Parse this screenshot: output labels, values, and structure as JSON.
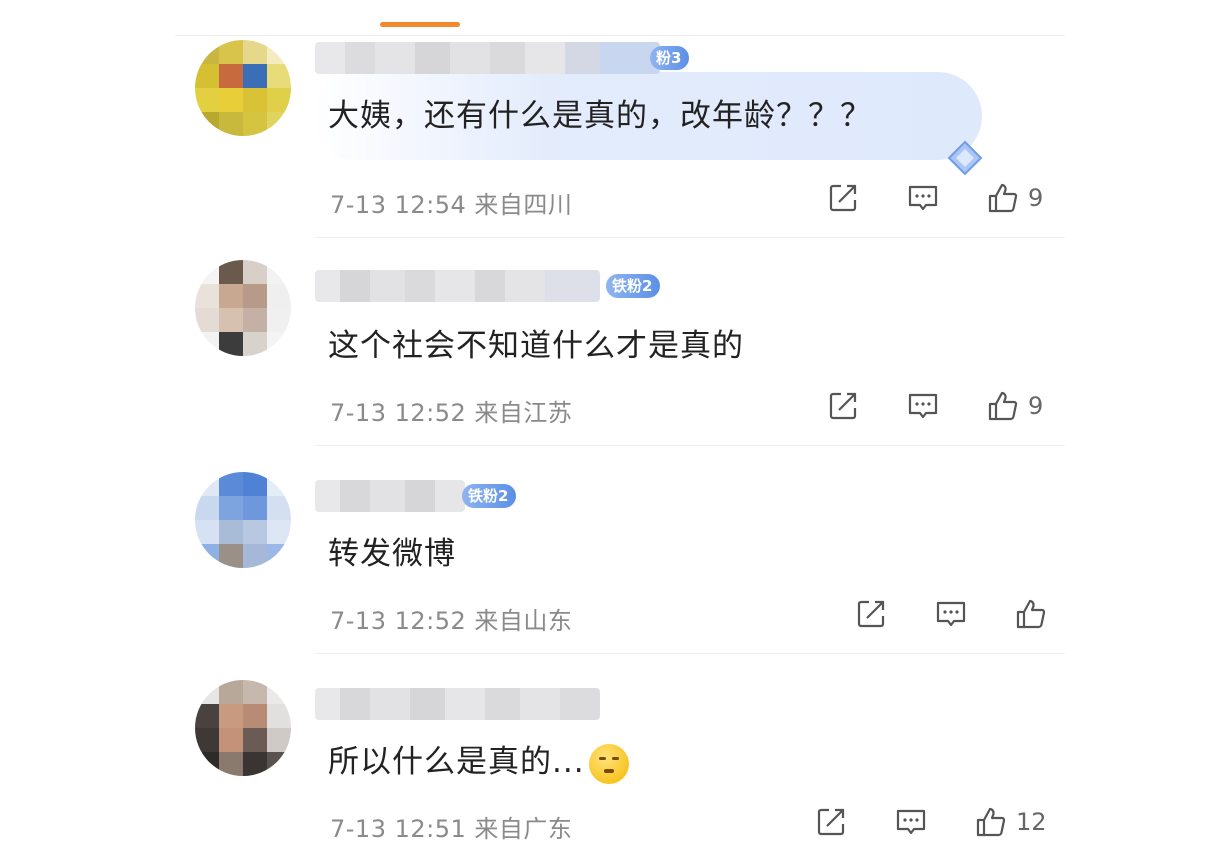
{
  "comments": [
    {
      "badge": "粉3",
      "text": "大姨，还有什么是真的，改年龄？？？",
      "time": "7-13 12:54",
      "location": "来自四川",
      "likes": "9"
    },
    {
      "badge": "铁粉2",
      "text": "这个社会不知道什么才是真的",
      "time": "7-13 12:52",
      "location": "来自江苏",
      "likes": "9"
    },
    {
      "badge": "铁粉2",
      "text": "转发微博",
      "time": "7-13 12:52",
      "location": "来自山东",
      "likes": ""
    },
    {
      "badge": "",
      "text": "所以什么是真的...",
      "emoji": "thinking-emoji",
      "time": "7-13 12:51",
      "location": "来自广东",
      "likes": "12"
    }
  ],
  "icons": {
    "repost": "repost-icon",
    "comment": "comment-icon",
    "like": "like-icon"
  },
  "colors": {
    "accent": "#f08a2c",
    "badge": "#6d9ae8",
    "text": "#222222",
    "meta": "#8a8a8a"
  }
}
